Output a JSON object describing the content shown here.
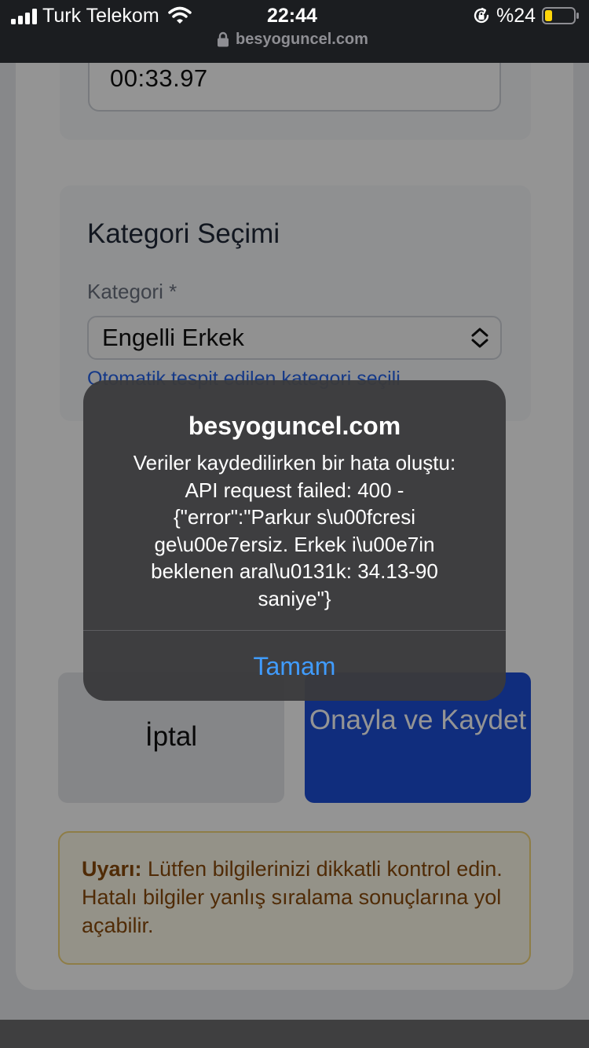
{
  "status_bar": {
    "carrier": "Turk Telekom",
    "time": "22:44",
    "battery_percent": "%24",
    "url": "besyoguncel.com"
  },
  "form": {
    "elapsed_time": "00:33.97",
    "category_section_title": "Kategori Seçimi",
    "category_label": "Kategori *",
    "category_selected": "Engelli Erkek",
    "category_note": "Otomatik tespit edilen kategori seçili"
  },
  "actions": {
    "cancel_label": "İptal",
    "save_label": "Onayla ve Kaydet"
  },
  "warning": {
    "label": "Uyarı:",
    "text": " Lütfen bilgilerinizi dikkatli kontrol edin. Hatalı bilgiler yanlış sıralama sonuçlarına yol açabilir."
  },
  "alert": {
    "title": "besyoguncel.com",
    "message": "Veriler kaydedilirken bir hata oluştu:\nAPI request failed: 400 -\n{\"error\":\"Parkur s\\u00fcresi\nge\\u00e7ersiz. Erkek i\\u00e7in\nbeklenen aral\\u0131k: 34.13-90\nsaniye\"}",
    "button_label": "Tamam"
  },
  "colors": {
    "primary": "#1d4ed8",
    "alert_button": "#409cff",
    "warning_text": "#8a4b0c",
    "battery_low": "#ffd60a"
  }
}
